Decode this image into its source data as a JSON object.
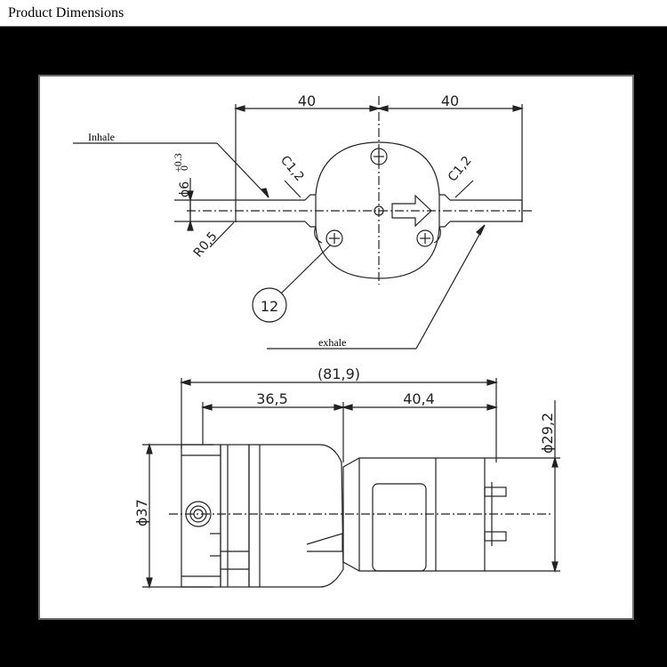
{
  "header": {
    "title": "Product Dimensions"
  },
  "top_view": {
    "dim_left": "40",
    "dim_right": "40",
    "chamfer_left": "C1,2",
    "chamfer_right": "C1,2",
    "port_diameter": "ϕ6",
    "port_tol": "+0.3",
    "port_tol2": "0",
    "radius": "R0,5",
    "callout_number": "12",
    "label_inhale": "Inhale",
    "label_exhale": "exhale"
  },
  "side_view": {
    "dim_total": "(81,9)",
    "dim_left": "36,5",
    "dim_right": "40,4",
    "dia_body": "ϕ37",
    "dia_motor": "ϕ29,2"
  }
}
